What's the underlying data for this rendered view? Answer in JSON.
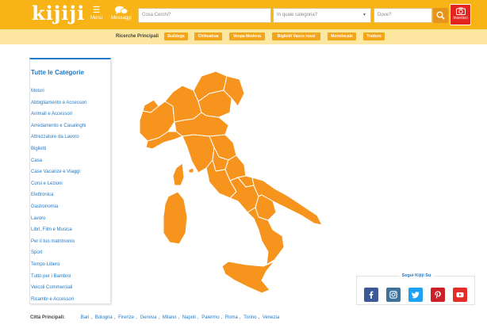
{
  "header": {
    "logo": "kijiji",
    "menu_label": "Menu",
    "messages_label": "Messaggi",
    "search_placeholder": "Cosa Cerchi?",
    "category_placeholder": "In quale categoria?",
    "where_placeholder": "Dove?",
    "insert_label": "Inserisci",
    "colors": {
      "brand": "#f8b316",
      "insert": "#e2251f",
      "search": "#e7941d"
    }
  },
  "subnav": {
    "label": "Ricerche Principali",
    "chips": [
      "Bulldogs",
      "Chihuahua",
      "Vespa Modena",
      "Biglietti Vasco rossi",
      "Monolocale",
      "Trattore"
    ]
  },
  "sidebar": {
    "title": "Tutte le Categorie",
    "items": [
      "Motori",
      "Abbigliamento e Accessori",
      "Animali e Accessori",
      "Arredamento e Casalinghi",
      "Attrezzature da Lavoro",
      "Biglietti",
      "Casa",
      "Case Vacanze e Viaggi",
      "Corsi e Lezioni",
      "Elettronica",
      "Gastronomia",
      "Lavoro",
      "Libri, Film e Musica",
      "Per il tuo matrimonio",
      "Sport",
      "Tempo Libero",
      "Tutto per i Bambini",
      "Veicoli Commerciali",
      "Ricambi e Accessori"
    ]
  },
  "map": {
    "color": "#f7941d",
    "region_line_color": "#ffffff",
    "icon": "italy-regions-map"
  },
  "social": {
    "title": "Segui Kijiji Su",
    "networks": [
      {
        "name": "facebook",
        "color": "#3b5998"
      },
      {
        "name": "instagram",
        "color": "#3f729b"
      },
      {
        "name": "twitter",
        "color": "#1da1f2"
      },
      {
        "name": "pinterest",
        "color": "#cb2027"
      },
      {
        "name": "youtube",
        "color": "#e52d27"
      }
    ]
  },
  "cities": {
    "label": "Città Principali:",
    "items": [
      "Bari",
      "Bologna",
      "Firenze",
      "Genova",
      "Milano",
      "Napoli",
      "Palermo",
      "Roma",
      "Torino",
      "Venezia"
    ]
  }
}
